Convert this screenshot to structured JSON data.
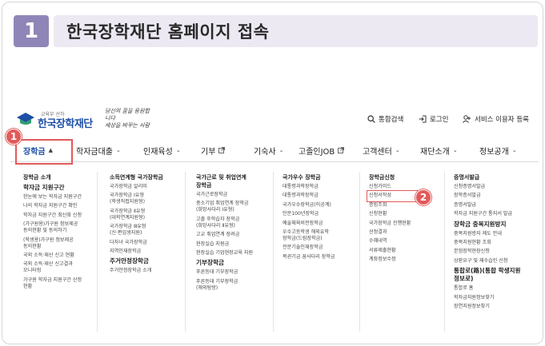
{
  "step": {
    "number": "1",
    "title": "한국장학재단 홈페이지 접속"
  },
  "logo": {
    "small": "교육부 산하",
    "name": "한국장학재단",
    "slogan_1": "당신의 꿈을 응원합니다",
    "slogan_2": "세상을 바꾸는 사람"
  },
  "utility": [
    {
      "label": "통합검색",
      "icon": "search-icon"
    },
    {
      "label": "로그인",
      "icon": "login-icon"
    },
    {
      "label": "서비스 이용자 등록",
      "icon": "user-register-icon"
    }
  ],
  "gnb": [
    {
      "label": "장학금",
      "suffix": "chevron-up-icon",
      "active": true
    },
    {
      "label": "학자금대출",
      "suffix": "chevron-down-icon"
    },
    {
      "label": "인재육성",
      "suffix": "chevron-down-icon"
    },
    {
      "label": "기부",
      "suffix": "external-link-icon"
    },
    {
      "label": "기숙사",
      "suffix": "chevron-down-icon"
    },
    {
      "label": "고졸인JOB",
      "suffix": "external-link-icon"
    },
    {
      "label": "고객센터",
      "suffix": "chevron-down-icon"
    },
    {
      "label": "재단소개",
      "suffix": "chevron-down-icon"
    },
    {
      "label": "정보공개",
      "suffix": "chevron-down-icon"
    }
  ],
  "markers": {
    "first": "1",
    "second": "2"
  },
  "menu": {
    "col1": {
      "heading": "장학금 소개",
      "sub": "학자금 지원구간",
      "items": [
        "한눈에 보는 학자금 지원구간",
        "나의 학자금 지원구간 확인",
        "학자금 지원구간 최신화 신청",
        "(가구원용)가구원 정보제공\n동의현황 및 동의하기",
        "(학생용)가구원 정보제공\n동의현황",
        "국외 소득·재산 신고 현황",
        "국외 소득·재산 신고결과\n모니터링",
        "가구원 학자금 지원구간 산정\n현황"
      ]
    },
    "col2": {
      "heading": "소득연계형 국가장학금",
      "items": [
        "국가장학금 알리미",
        "국가장학금 Ⅰ유형\n(학생직접지원형)",
        "국가장학금 Ⅱ유형\n(대학연계지원형)",
        "국가장학금 Ⅲ유형\n(신·편입생지원)",
        "다자녀 국가장학금",
        "지역인재장학금"
      ],
      "sub": "주거안정장학금",
      "items2": [
        "주거안정장학금 소개"
      ]
    },
    "col3": {
      "heading": "국가근로 및 취업연계\n장학금",
      "items": [
        "국가근로장학금",
        "중소기업 취업연계 장학금\n(희망사다리 Ⅰ유형)",
        "고졸 후학습자 장학금\n(희망사다리 Ⅱ유형)",
        "고교 취업연계 장려금",
        "현장실습 지원금",
        "현장실습 기업현장교육 지원"
      ],
      "sub": "기부장학금",
      "items2": [
        "푸른등대 기부장학금",
        "푸른등대 기부장학금\n(해외탐방)"
      ]
    },
    "col4": {
      "heading": "국가우수 장학금",
      "items": [
        "대통령과학장학금",
        "대통령과학장학금",
        "국가우수장학금(이공계)",
        "인문100년장학금",
        "예술체육비전장학금",
        "우수고등학생 해외유학\n장학금(드림장학금)",
        "전문기술인재장학금",
        "복권기금 꿈사다리 장학금"
      ]
    },
    "col5": {
      "heading": "장학금신청",
      "items": [
        "신청가이드",
        "신청서작성",
        "증빙조회",
        "신청현황",
        "국가장학금 진행현황",
        "선정결과",
        "수혜내역",
        "서류제출현황",
        "계좌정보수정"
      ]
    },
    "col6": {
      "heading": "증명서발급",
      "items": [
        "신청증명서발급",
        "장학증서발급",
        "증명서발급",
        "학자금 지원구간 통지서 발급"
      ],
      "sub": "장학금 중복지원방지",
      "items2": [
        "중복지원방지 제도 안내",
        "중복지원현황 조회",
        "본험장학현장신청",
        "상환요구 및 재수습인 신청"
      ],
      "sub2": "통합로(路)(통합 학생지원\n정보로)",
      "items3": [
        "통합로 홈",
        "학자금지원정보찾기",
        "장연지원정보찾기"
      ]
    }
  }
}
